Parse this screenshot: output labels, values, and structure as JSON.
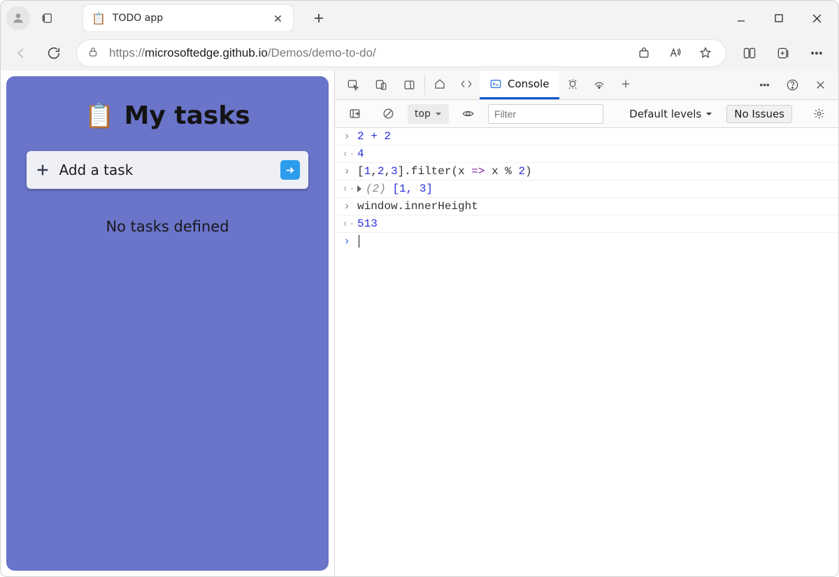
{
  "window": {
    "tab_title": "TODO app",
    "url_scheme": "https://",
    "url_host": "microsoftedge.github.io",
    "url_path": "/Demos/demo-to-do/"
  },
  "page": {
    "heading": "My tasks",
    "add_placeholder": "Add a task",
    "empty_state": "No tasks defined"
  },
  "devtools": {
    "console_tab": "Console",
    "context": "top",
    "filter_placeholder": "Filter",
    "levels": "Default levels",
    "issues": "No Issues",
    "log": {
      "i1": "2 + 2",
      "o1": "4",
      "i2_a": "[",
      "i2_b": "1",
      "i2_c": ",",
      "i2_d": "2",
      "i2_e": ",",
      "i2_f": "3",
      "i2_g": "].filter(",
      "i2_h": "x",
      "i2_i": " => ",
      "i2_j": "x % ",
      "i2_k": "2",
      "i2_l": ")",
      "o2_len": "(2) ",
      "o2_arr": "[1, 3]",
      "i3": "window.innerHeight",
      "o3": "513"
    }
  }
}
